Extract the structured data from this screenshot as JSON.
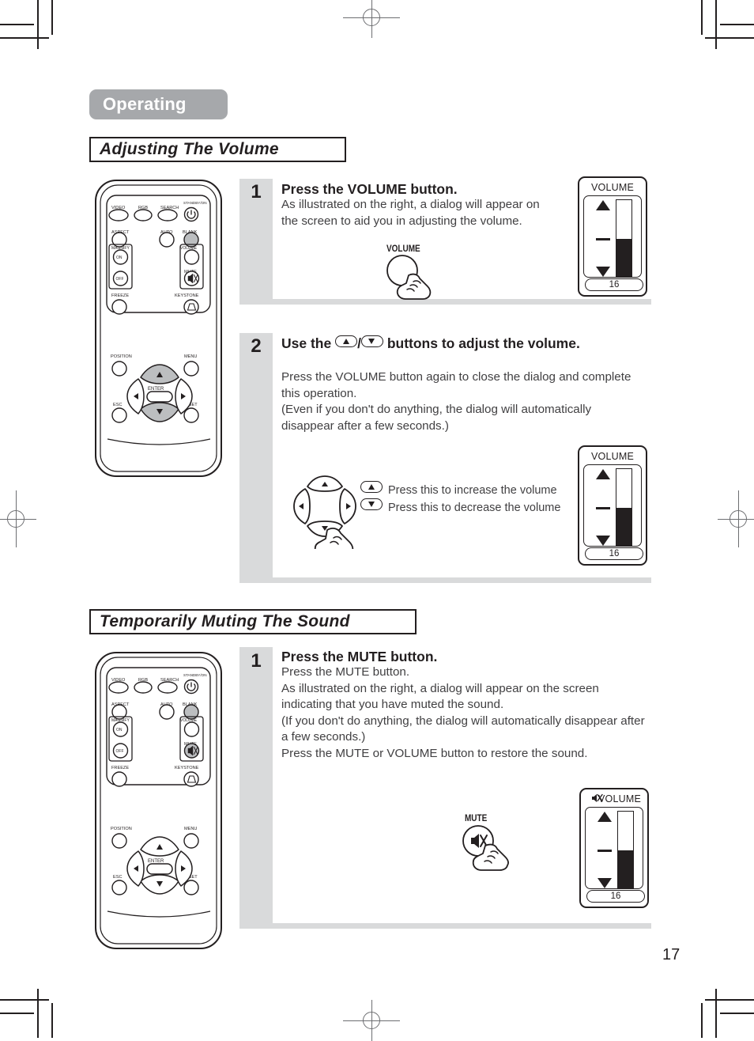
{
  "page": {
    "number": "17",
    "chapter": "Operating"
  },
  "sections": [
    {
      "id": "adjusting-volume",
      "title": "Adjusting The Volume",
      "steps": [
        {
          "number": "1",
          "title": "Press the VOLUME button.",
          "body": "As illustrated on the right, a dialog will appear on the screen to aid you in adjusting the volume.",
          "press_label": "VOLUME"
        },
        {
          "number": "2",
          "title_before": "Use the ",
          "title_mid": "/",
          "title_after": " buttons to adjust the volume.",
          "body": "Press the VOLUME button again to close the dialog and complete this operation.\n(Even if you don't do anything, the dialog will automatically disappear after a few seconds.)",
          "legend": [
            {
              "key": "up",
              "text": "Press this to increase the volume"
            },
            {
              "key": "down",
              "text": "Press this to decrease the volume"
            }
          ]
        }
      ]
    },
    {
      "id": "muting-sound",
      "title": "Temporarily Muting The Sound",
      "steps": [
        {
          "number": "1",
          "title": "Press the MUTE button.",
          "body": "Press the MUTE button.\nAs illustrated on the right, a dialog will appear on the screen indicating that you have muted the sound.\n(If you don't do anything, the dialog will automatically disappear after a few seconds.)\nPress the MUTE or VOLUME button to restore the sound.",
          "press_label": "MUTE"
        }
      ]
    }
  ],
  "osd_dialogs": [
    {
      "id": "volume-osd-step1",
      "title": "VOLUME",
      "value": "16",
      "fill_percent": 50,
      "muted": false
    },
    {
      "id": "volume-osd-step2",
      "title": "VOLUME",
      "value": "16",
      "fill_percent": 50,
      "muted": false
    },
    {
      "id": "volume-osd-mute",
      "title": "VOLUME",
      "value": "16",
      "fill_percent": 50,
      "muted": true
    }
  ],
  "remote": {
    "buttons": {
      "video": "VIDEO",
      "rgb": "RGB",
      "search": "SEARCH",
      "standby_on": "STANDBY/ON",
      "aspect": "ASPECT",
      "auto": "AUTO",
      "blank": "BLANK",
      "magnify": "MAGNIFY",
      "magnify_on": "ON",
      "magnify_off": "OFF",
      "freeze": "FREEZE",
      "volume": "VOLUME",
      "mute": "MUTE",
      "keystone": "KEYSTONE",
      "position": "POSITION",
      "menu": "MENU",
      "enter": "ENTER",
      "esc": "ESC",
      "reset": "RESET"
    }
  },
  "colors": {
    "tab_gray": "#a6a8ab",
    "band_gray": "#d9dadb",
    "highlight_gray": "#bcbec0",
    "ink": "#231f20"
  }
}
